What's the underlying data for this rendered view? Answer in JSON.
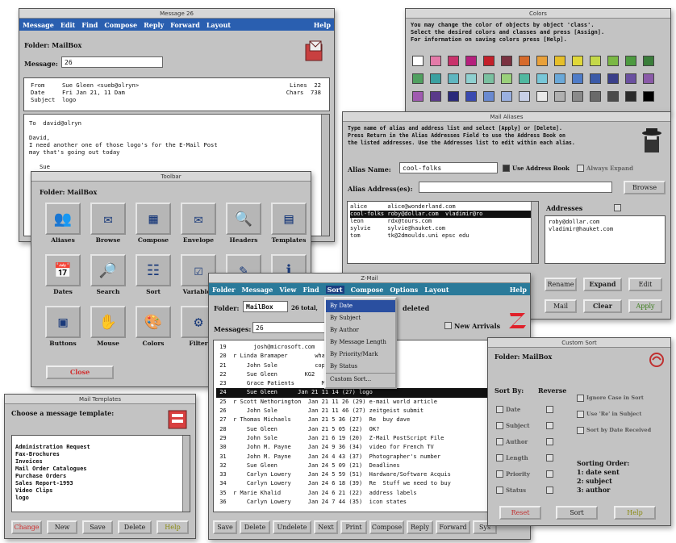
{
  "message_win": {
    "title": "Message 26",
    "menu": [
      "Message",
      "Edit",
      "Find",
      "Compose",
      "Reply",
      "Forward",
      "Layout"
    ],
    "help": "Help",
    "folder_label": "Folder: MailBox",
    "message_label": "Message:",
    "message_value": "26",
    "header_lines": [
      "From     Sue Gleen <sueb@olryn>",
      "Date     Fri Jan 21, 11 Dam",
      "Subject  logo"
    ],
    "lines_label": "Lines  22",
    "chars_label": "Chars  738",
    "body": "To  david@olryn\n\nDavid,\nI need another one of those logo's for the E-Mail Post\nmay that's going out today\n\n   Sue"
  },
  "colors_win": {
    "title": "Colors",
    "instructions": "You may change the color of objects by object 'class'.\nSelect the desired colors and classes and press [Assign].\nFor information on saving colors press [Help].",
    "palette": [
      [
        "#ffffff",
        "#e47aa8",
        "#c9326b",
        "#b5207d",
        "#c3202a",
        "#7a3140",
        "#d66a2b",
        "#e9a13a",
        "#e6bf2a",
        "#e0d83a",
        "#c4d848",
        "#7ab844",
        "#4d9a40",
        "#3a7d3a"
      ],
      [
        "#50a060",
        "#3aa0a0",
        "#5fb6c0",
        "#8fd0d0",
        "#7ac0a0",
        "#9ad07a",
        "#50b8a0",
        "#78c7d8",
        "#6aa8d8",
        "#4f7cc8",
        "#3b5aa8",
        "#3a3f8a",
        "#6a50a0",
        "#8a5aa8"
      ],
      [
        "#a05ab0",
        "#5a3a8a",
        "#2a2a7a",
        "#3a4ab0",
        "#6a8ad0",
        "#9ab0e0",
        "#c8d0e8",
        "#e8e8e8",
        "#b0b0b0",
        "#8a8a8a",
        "#6a6a6a",
        "#4a4a4a",
        "#2a2a2a",
        "#000000"
      ]
    ]
  },
  "aliases_win": {
    "title": "Mail Aliases",
    "instructions": "Type name of alias and address list and select [Apply] or [Delete].\nPress Return in the Alias Addresses Field to use the Address Book on\nthe listed addresses. Use the Addresses list to edit within each alias.",
    "alias_name_label": "Alias Name:",
    "alias_name_value": "cool-folks",
    "use_address_book": "Use Address Book",
    "always_expand": "Always Expand",
    "alias_addresses_label": "Alias Address(es):",
    "browse": "Browse",
    "alias_rows": [
      "alice      alice@wonderland.com",
      "cool-folks roby@dollar.com  vladimir@ro",
      "leon       rdx@tours.com",
      "sylvie     sylvie@hauket.com",
      "tom        tk@2dmoulds.uni epsc edu"
    ],
    "addresses_label": "Addresses",
    "addresses": [
      "roby@dollar.com",
      "vladimir@hauket.com"
    ],
    "buttons": [
      "Rename",
      "Expand",
      "Edit",
      "Mail",
      "Clear",
      "Apply"
    ]
  },
  "toolbar_win": {
    "title": "Toolbar",
    "folder_label": "Folder: MailBox",
    "icons": [
      "Aliases",
      "Browse",
      "Compose",
      "Envelope",
      "Headers",
      "Templates",
      "Dates",
      "Search",
      "Sort",
      "Variables",
      "",
      "",
      "Buttons",
      "Mouse",
      "Colors",
      "Filter"
    ],
    "close_label": "Close"
  },
  "templates_win": {
    "title": "Mail Templates",
    "prompt": "Choose a message template:",
    "items": [
      "Administration Request",
      "Fax-Brochures",
      "Invoices",
      "Mail Order Catalogues",
      "Purchase Orders",
      "Sales Report-1993",
      "Video Clips",
      "logo"
    ],
    "buttons": [
      "Change",
      "New",
      "Save",
      "Delete",
      "Help"
    ]
  },
  "zmail_win": {
    "title": "Z-Mail",
    "menu": [
      "Folder",
      "Message",
      "View",
      "Find",
      "Sort",
      "Compose",
      "Options",
      "Layout"
    ],
    "help": "Help",
    "folder_label": "Folder:",
    "folder_value": "MailBox",
    "folder_total": "26 total,",
    "deleted_label": "deleted",
    "messages_label": "Messages:",
    "messages_value": "26",
    "new_arrivals": "New Arrivals",
    "rows": [
      " 19        josh@microsoft.com        WorldBoard News",
      " 20  r Linda Bramaper        what's on your plate",
      " 21      John Sole           copyright-free pict",
      " 22      Sue Gleen        KG2",
      " 23      Grace Patients        MediaMail Icons",
      " 24      Sue Gleen      Jan 21 11 14 (27) logo",
      " 25  r Scott Nethorington  Jan 21 11 26 (29) e-mail world article",
      " 26      John Sole         Jan 21 11 46 (27) zeitgeist submit",
      " 27  r Thomas Michaels     Jan 21 5 36 (27)  Re  buy dave",
      " 28      Sue Gleen         Jan 21 5 05 (22)  OK?",
      " 29      John Sole         Jan 21 6 19 (20)  Z-Mail PostScript File",
      " 30      John M. Payne     Jan 24 9 36 (34)  video for French TV",
      " 31      John M. Payne     Jan 24 4 43 (37)  Photographer's number",
      " 32      Sue Gleen         Jan 24 5 09 (21)  Deadlines",
      " 33      Carlyn Lowery     Jan 24 5 59 (51)  Hardware/Software Acquis",
      " 34      Carlyn Lowery     Jan 24 6 18 (39)  Re  Stuff we need to buy",
      " 35  r Marie Khalid        Jan 24 6 21 (22)  address labels",
      " 36      Carlyn Lowery     Jan 24 7 44 (35)  icon states"
    ],
    "selected_row": 5,
    "sort_menu": [
      "By Date",
      "By Subject",
      "By Author",
      "By Message Length",
      "By Priority/Mark",
      "By Status",
      "Custom Sort..."
    ],
    "buttons": [
      "Save",
      "Delete",
      "Undelete",
      "Next",
      "Print",
      "Compose",
      "Reply",
      "Forward",
      "Sys"
    ]
  },
  "sort_win": {
    "title": "Custom Sort",
    "folder_label": "Folder: MailBox",
    "sort_by_label": "Sort By:",
    "reverse_label": "Reverse",
    "options": [
      "Date",
      "Subject",
      "Author",
      "Length",
      "Priority",
      "Status"
    ],
    "checks": [
      "Ignore Case in Sort",
      "Use 'Re' in Subject",
      "Sort by Date Received"
    ],
    "order_title": "Sorting Order:",
    "order": [
      "1: date sent",
      "2: subject",
      "3: author"
    ],
    "buttons": [
      "Reset",
      "Sort",
      "Help"
    ]
  }
}
